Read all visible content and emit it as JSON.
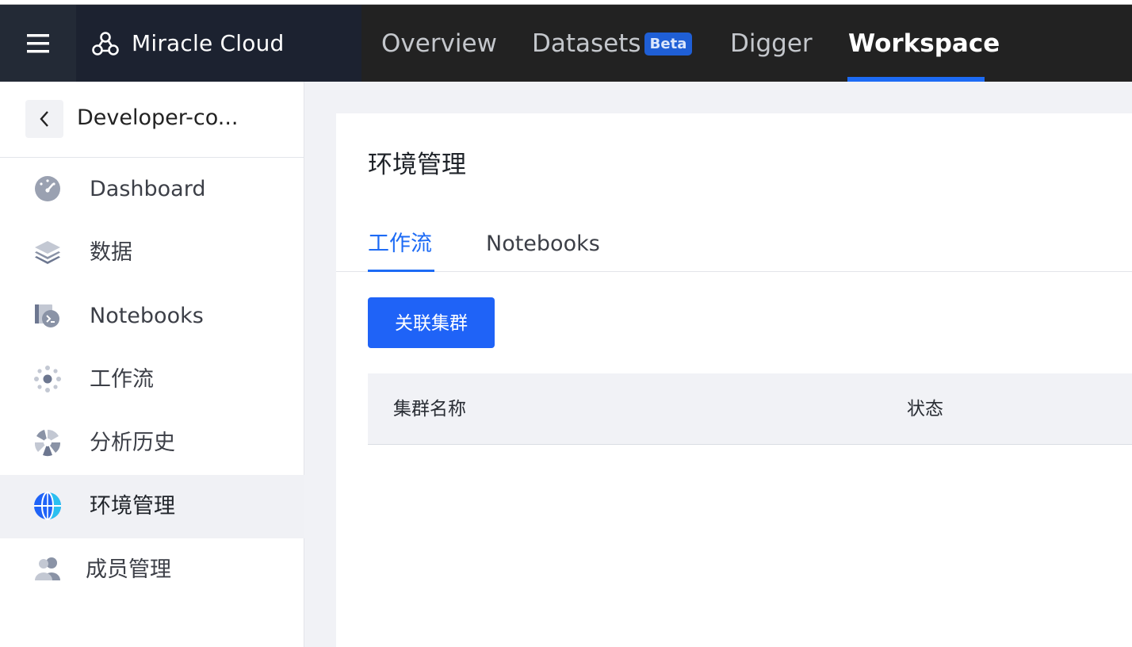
{
  "app": {
    "brand_name": "Miracle Cloud",
    "icons": {
      "menu": "hamburger-menu-icon",
      "brand": "miracle-cloud-logo-icon"
    }
  },
  "top_nav": {
    "items": [
      {
        "label": "Overview",
        "active": false
      },
      {
        "label": "Datasets",
        "active": false,
        "badge": "Beta"
      },
      {
        "label": "Digger",
        "active": false
      },
      {
        "label": "Workspace",
        "active": true
      }
    ],
    "accent_color": "#1d6bf5"
  },
  "sidebar": {
    "project_name": "Developer-co...",
    "back_icon": "chevron-left-icon",
    "items": [
      {
        "label": "Dashboard",
        "icon": "dashboard-gauge-icon",
        "active": false
      },
      {
        "label": "数据",
        "icon": "layers-icon",
        "active": false
      },
      {
        "label": "Notebooks",
        "icon": "notebook-terminal-icon",
        "active": false
      },
      {
        "label": "工作流",
        "icon": "workflow-nodes-icon",
        "active": false
      },
      {
        "label": "分析历史",
        "icon": "analysis-history-icon",
        "active": false
      },
      {
        "label": "环境管理",
        "icon": "globe-icon",
        "active": true
      },
      {
        "label": "成员管理",
        "icon": "members-icon",
        "active": false
      }
    ]
  },
  "main": {
    "title": "环境管理",
    "tabs": [
      {
        "label": "工作流",
        "active": true
      },
      {
        "label": "Notebooks",
        "active": false
      }
    ],
    "associate_button": "关联集群",
    "table": {
      "columns": [
        "集群名称",
        "状态"
      ],
      "rows": []
    }
  }
}
